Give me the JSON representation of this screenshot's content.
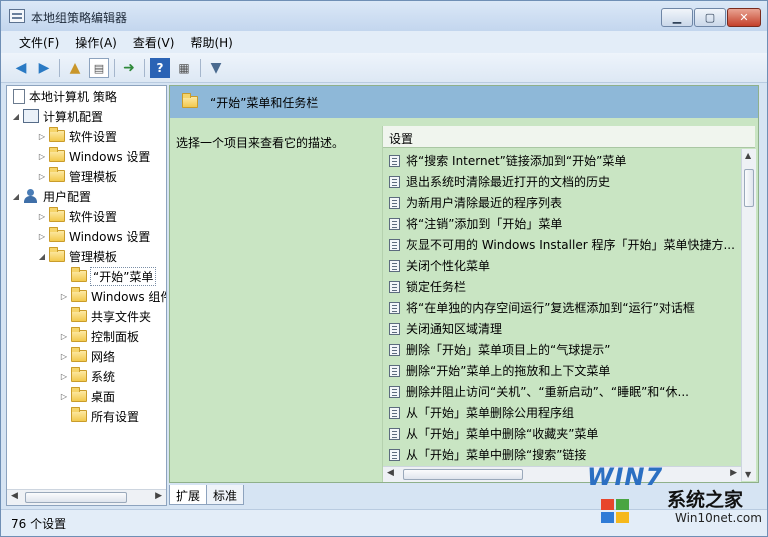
{
  "window": {
    "title": "本地组策略编辑器"
  },
  "menu": [
    "文件(F)",
    "操作(A)",
    "查看(V)",
    "帮助(H)"
  ],
  "tree": {
    "root": "本地计算机 策略",
    "computer": "计算机配置",
    "computer_children": [
      "软件设置",
      "Windows 设置",
      "管理模板"
    ],
    "user": "用户配置",
    "user_children": [
      "软件设置",
      "Windows 设置",
      "管理模板"
    ],
    "admin_children": [
      "“开始”菜单",
      "Windows 组件",
      "共享文件夹",
      "控制面板",
      "网络",
      "系统",
      "桌面",
      "所有设置"
    ]
  },
  "right": {
    "header": "“开始”菜单和任务栏",
    "description": "选择一个项目来查看它的描述。",
    "column": "设置",
    "items": [
      "将“搜索 Internet”链接添加到“开始”菜单",
      "退出系统时清除最近打开的文档的历史",
      "为新用户清除最近的程序列表",
      "将“注销”添加到「开始」菜单",
      "灰显不可用的 Windows Installer 程序「开始」菜单快捷方...",
      "关闭个性化菜单",
      "锁定任务栏",
      "将“在单独的内存空间运行”复选框添加到“运行”对话框",
      "关闭通知区域清理",
      "删除「开始」菜单项目上的“气球提示”",
      "删除“开始”菜单上的拖放和上下文菜单",
      "删除并阻止访问“关机”、“重新启动”、“睡眠”和“休...",
      "从「开始」菜单删除公用程序组",
      "从「开始」菜单中删除“收藏夹”菜单",
      "从「开始」菜单中删除“搜索”链接"
    ]
  },
  "tabs": [
    "扩展",
    "标准"
  ],
  "status": "76 个设置",
  "watermark": {
    "logo": "WIN7",
    "name": "系统之家",
    "url": "Win10net.com"
  }
}
